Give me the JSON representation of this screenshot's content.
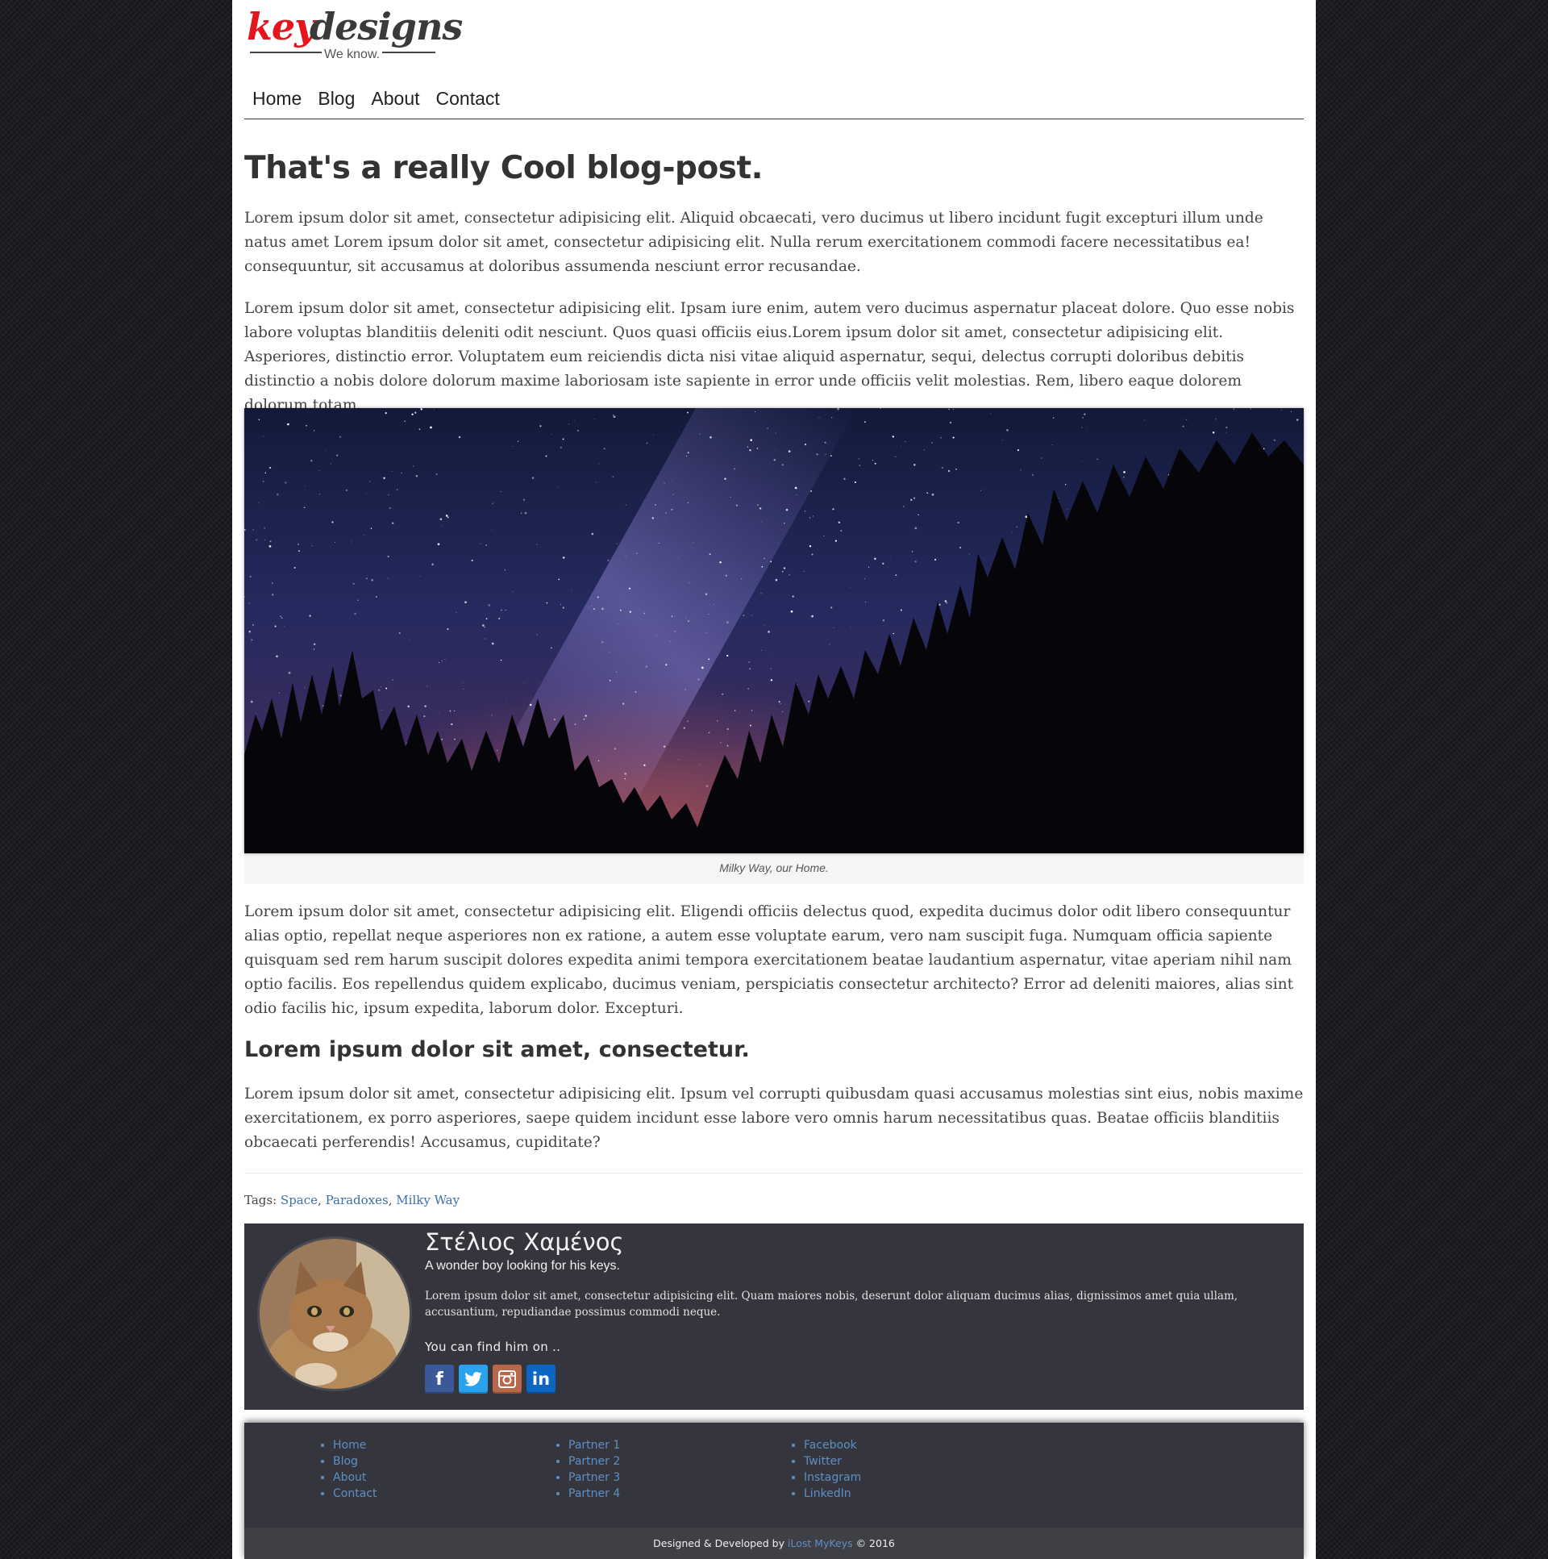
{
  "logo": {
    "key": "key",
    "designs": "designs",
    "tagline": "We know."
  },
  "nav": [
    "Home",
    "Blog",
    "About",
    "Contact"
  ],
  "post": {
    "title": "That's a really Cool blog-post.",
    "p1": "Lorem ipsum dolor sit amet, consectetur adipisicing elit. Aliquid obcaecati, vero ducimus ut libero incidunt fugit excepturi illum unde natus amet Lorem ipsum dolor sit amet, consectetur adipisicing elit. Nulla rerum exercitationem commodi facere necessitatibus ea! consequuntur, sit accusamus at doloribus assumenda nesciunt error recusandae.",
    "p2": "Lorem ipsum dolor sit amet, consectetur adipisicing elit. Ipsam iure enim, autem vero ducimus aspernatur placeat dolore. Quo esse nobis labore voluptas blanditiis deleniti odit nesciunt. Quos quasi officiis eius.Lorem ipsum dolor sit amet, consectetur adipisicing elit. Asperiores, distinctio error. Voluptatem eum reiciendis dicta nisi vitae aliquid aspernatur, sequi, delectus corrupti doloribus debitis distinctio a nobis dolore dolorum maxime laboriosam iste sapiente in error unde officiis velit molestias. Rem, libero eaque dolorem dolorum totam.",
    "caption": "Milky Way, our Home.",
    "p3": "Lorem ipsum dolor sit amet, consectetur adipisicing elit. Eligendi officiis delectus quod, expedita ducimus dolor odit libero consequuntur alias optio, repellat neque asperiores non ex ratione, a autem esse voluptate earum, vero nam suscipit fuga. Numquam officia sapiente quisquam sed rem harum suscipit dolores expedita animi tempora exercitationem beatae laudantium aspernatur, vitae aperiam nihil nam optio facilis. Eos repellendus quidem explicabo, ducimus veniam, perspiciatis consectetur architecto? Error ad deleniti maiores, alias sint odio facilis hic, ipsum expedita, laborum dolor. Excepturi.",
    "subheading": "Lorem ipsum dolor sit amet, consectetur.",
    "p4": "Lorem ipsum dolor sit amet, consectetur adipisicing elit. Ipsum vel corrupti quibusdam quasi accusamus molestias sint eius, nobis maxime exercitationem, ex porro asperiores, saepe quidem incidunt esse labore vero omnis harum necessitatibus quas. Beatae officiis blanditiis obcaecati perferendis! Accusamus, cupiditate?",
    "tags_label": "Tags:",
    "tags": [
      "Space",
      "Paradoxes",
      "Milky Way"
    ]
  },
  "author": {
    "name": "Στέλιος Χαμένος",
    "tagline": "A wonder boy looking for his keys.",
    "bio": "Lorem ipsum dolor sit amet, consectetur adipisicing elit. Quam maiores nobis, deserunt dolor aliquam ducimus alias, dignissimos amet quia ullam, accusantium, repudiandae possimus commodi neque.",
    "find_label": "You can find him on ..",
    "socials": [
      "facebook-icon",
      "twitter-icon",
      "instagram-icon",
      "linkedin-icon"
    ]
  },
  "footer": {
    "col1": [
      "Home",
      "Blog",
      "About",
      "Contact"
    ],
    "col2": [
      "Partner 1",
      "Partner 2",
      "Partner 3",
      "Partner 4"
    ],
    "col3": [
      "Facebook",
      "Twitter",
      "Instagram",
      "LinkedIn"
    ],
    "credit_prefix": "Designed & Developed by",
    "credit_name": "iLost MyKeys",
    "credit_suffix": "© 2016"
  },
  "colors": {
    "accent_red": "#e3161e",
    "link_blue": "#3d6ea8",
    "panel": "#35363d"
  }
}
